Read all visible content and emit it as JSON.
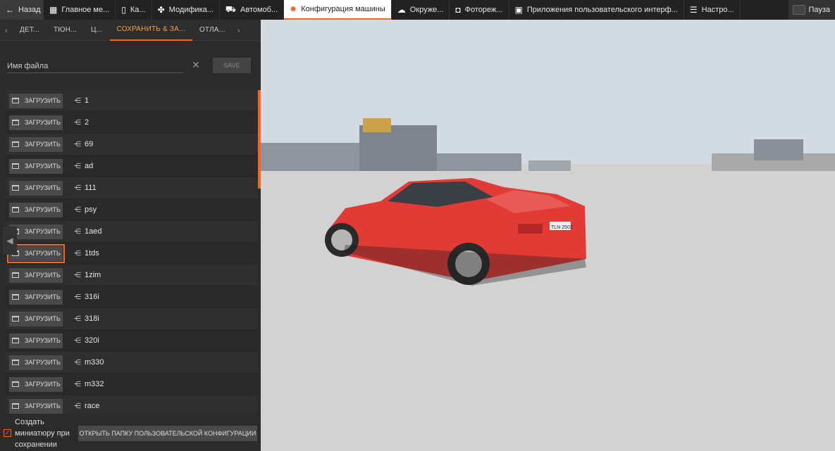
{
  "topbar": {
    "back": "Назад",
    "tabs": [
      {
        "label": "Главное ме...",
        "icon": "dashboard-icon"
      },
      {
        "label": "Ка...",
        "icon": "map-icon"
      },
      {
        "label": "Модифика...",
        "icon": "puzzle-icon"
      },
      {
        "label": "Автомоб...",
        "icon": "car-icon"
      },
      {
        "label": "Конфигурация машины",
        "icon": "gear-car-icon"
      },
      {
        "label": "Окруже...",
        "icon": "weather-icon"
      },
      {
        "label": "Фотореж...",
        "icon": "camera-icon"
      },
      {
        "label": "Приложения пользовательского интерф...",
        "icon": "apps-icon"
      },
      {
        "label": "Настро...",
        "icon": "sliders-icon"
      }
    ],
    "pause": "Пауза"
  },
  "subtabs": [
    "ДЕТ...",
    "ТЮН...",
    "Ц...",
    "СОХРАНИТЬ & ЗА...",
    "ОТЛА..."
  ],
  "save": {
    "placeholder": "Имя файла",
    "save_label": "SAVE"
  },
  "configs": [
    {
      "load": "ЗАГРУЗИТЬ",
      "name": "1"
    },
    {
      "load": "ЗАГРУЗИТЬ",
      "name": "2"
    },
    {
      "load": "ЗАГРУЗИТЬ",
      "name": "69"
    },
    {
      "load": "ЗАГРУЗИТЬ",
      "name": "ad"
    },
    {
      "load": "ЗАГРУЗИТЬ",
      "name": "111"
    },
    {
      "load": "ЗАГРУЗИТЬ",
      "name": "psy"
    },
    {
      "load": "ЗАГРУЗИТЬ",
      "name": "1aed"
    },
    {
      "load": "ЗАГРУЗИТЬ",
      "name": "1tds"
    },
    {
      "load": "ЗАГРУЗИТЬ",
      "name": "1zim"
    },
    {
      "load": "ЗАГРУЗИТЬ",
      "name": "316i"
    },
    {
      "load": "ЗАГРУЗИТЬ",
      "name": "318i"
    },
    {
      "load": "ЗАГРУЗИТЬ",
      "name": "320i"
    },
    {
      "load": "ЗАГРУЗИТЬ",
      "name": "m330"
    },
    {
      "load": "ЗАГРУЗИТЬ",
      "name": "m332"
    },
    {
      "load": "ЗАГРУЗИТЬ",
      "name": "race"
    }
  ],
  "bottom": {
    "thumbnail_label": "Создать миниатюру при сохранении",
    "thumbnail_checked": true,
    "open_folder": "ОТКРЫТЬ ПАПКУ ПОЛЬЗОВАТЕЛЬСКОЙ КОНФИГУРАЦИИ"
  },
  "scene": {
    "license_plate": "TLN 2502"
  },
  "colors": {
    "accent": "#f26522",
    "car": "#e23b36"
  }
}
